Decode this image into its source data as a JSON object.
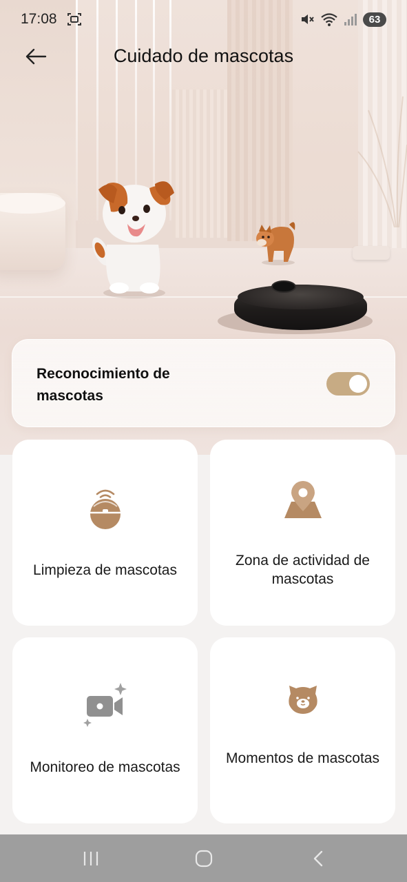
{
  "status_bar": {
    "time": "17:08",
    "battery": "63",
    "icons": [
      "screenshot-icon",
      "mute-icon",
      "wifi-icon",
      "signal-icon"
    ]
  },
  "header": {
    "title": "Cuidado de mascotas",
    "back_icon": "arrow-left-icon"
  },
  "pet_recognition": {
    "label": "Reconocimiento de mascotas",
    "enabled": true
  },
  "tiles": [
    {
      "label": "Limpieza de mascotas",
      "icon": "robot-wifi-icon"
    },
    {
      "label": "Zona de actividad de mascotas",
      "icon": "map-pin-icon"
    },
    {
      "label": "Monitoreo de mascotas",
      "icon": "video-camera-icon"
    },
    {
      "label": "Momentos de mascotas",
      "icon": "pet-face-icon"
    }
  ],
  "nav_bar": {
    "buttons": [
      "recent-apps-icon",
      "home-icon",
      "back-icon"
    ]
  },
  "colors": {
    "accent": "#c7ab84",
    "icon_brown": "#b58a63",
    "icon_gray": "#909090",
    "tile_bg": "#ffffff",
    "page_bg": "#f4f2f1",
    "nav_bg": "#9e9e9e"
  }
}
